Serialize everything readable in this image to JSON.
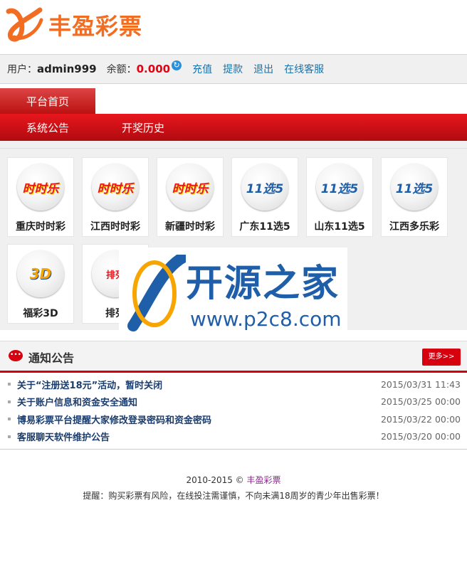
{
  "app": {
    "logo_text": "丰盈彩票"
  },
  "user": {
    "label": "用户：",
    "name": "admin999",
    "balance_label": "余额：",
    "balance": "0.000",
    "links": [
      "充值",
      "提款",
      "退出",
      "在线客服"
    ]
  },
  "nav": {
    "active_tab": "平台首页",
    "items": [
      "系统公告",
      "开奖历史"
    ]
  },
  "games": [
    {
      "name": "重庆时时彩",
      "icon": "ssc-icon",
      "icon_text": "时时乐"
    },
    {
      "name": "江西时时彩",
      "icon": "ssc-icon",
      "icon_text": "时时乐"
    },
    {
      "name": "新疆时时彩",
      "icon": "ssc-icon",
      "icon_text": "时时乐"
    },
    {
      "name": "广东11选5",
      "icon": "11x5-icon",
      "icon_text": "11选5"
    },
    {
      "name": "山东11选5",
      "icon": "11x5-icon",
      "icon_text": "11选5"
    },
    {
      "name": "江西多乐彩",
      "icon": "11x5-icon",
      "icon_text": "11选5"
    },
    {
      "name": "福彩3D",
      "icon": "3d-icon",
      "icon_text": "3D"
    },
    {
      "name": "排列",
      "icon": "pailie-icon",
      "icon_text": "排列"
    }
  ],
  "watermark": {
    "title": "开源之家",
    "url": "www.p2c8.com"
  },
  "notices": {
    "title": "通知公告",
    "more_label": "更多>>",
    "items": [
      {
        "title": "关于“注册送18元”活动，暂时关闭",
        "date": "2015/03/31 11:43"
      },
      {
        "title": "关于账户信息和资金安全通知",
        "date": "2015/03/25 00:00"
      },
      {
        "title": "博易彩票平台提醒大家修改登录密码和资金密码",
        "date": "2015/03/22 00:00"
      },
      {
        "title": "客服聊天软件维护公告",
        "date": "2015/03/20 00:00"
      }
    ]
  },
  "footer": {
    "copyright": "2010-2015 ©",
    "brand": "丰盈彩票",
    "reminder": "提醒：购买彩票有风险，在线投注需谨慎，不向未满18周岁的青少年出售彩票！"
  },
  "colors": {
    "brand_orange": "#f26d22",
    "nav_red": "#d7000f",
    "link_blue": "#1b72a8"
  }
}
